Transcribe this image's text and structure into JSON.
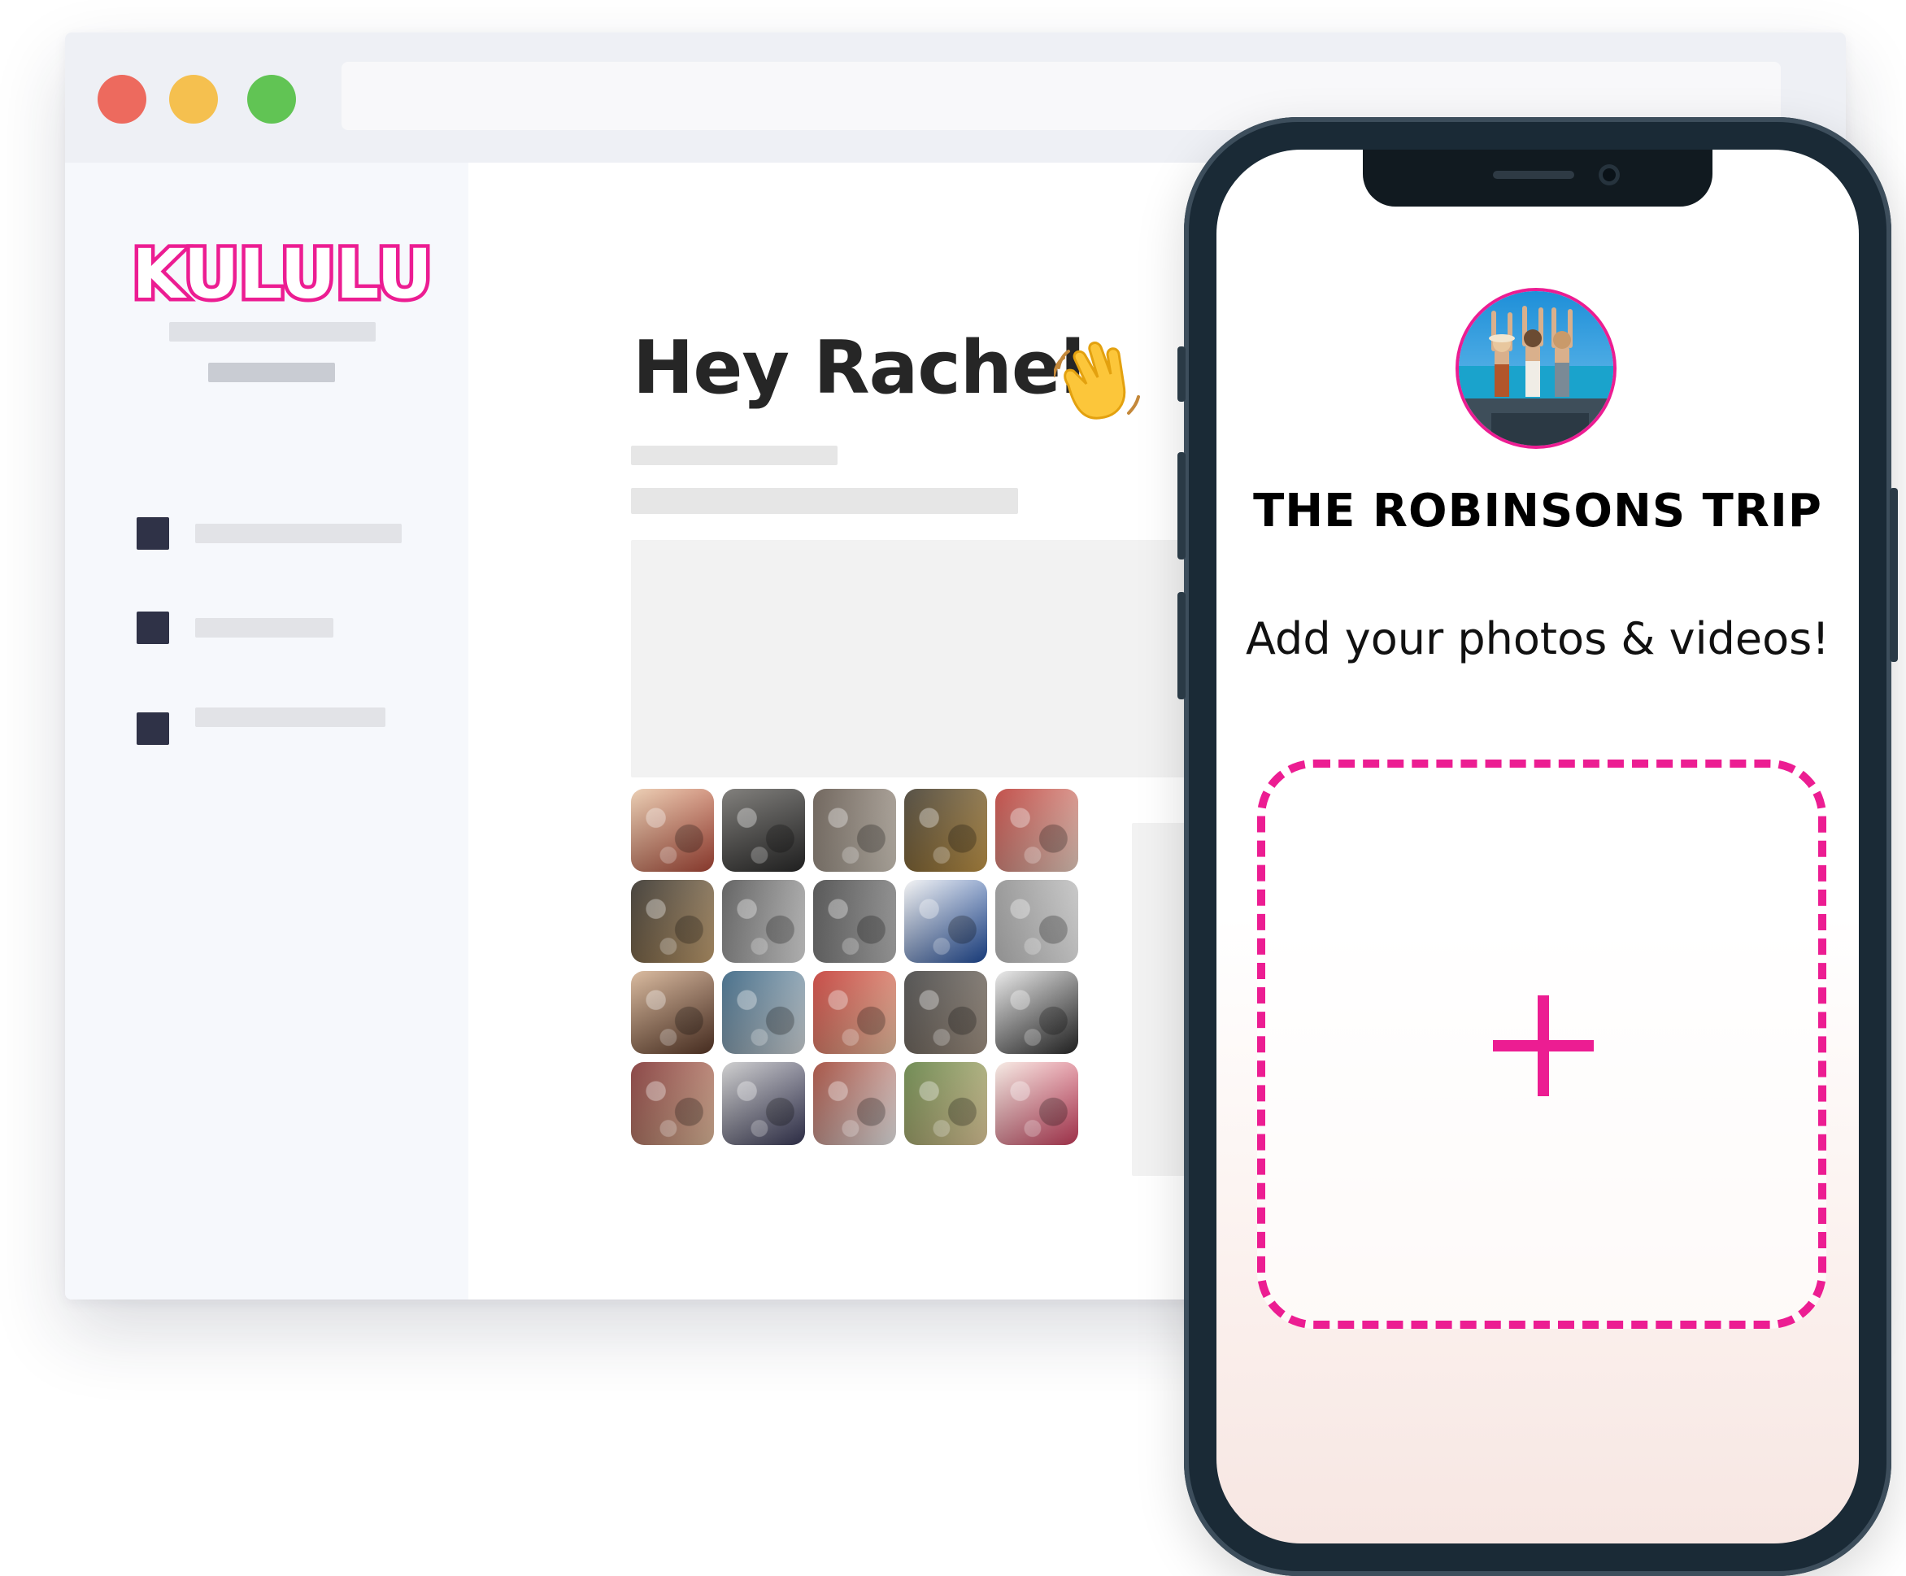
{
  "browser": {
    "window_controls": [
      "close",
      "minimize",
      "maximize"
    ],
    "address_bar": ""
  },
  "sidebar": {
    "logo_text": "KULULU",
    "nav_items": [
      "square-icon",
      "square-icon",
      "square-icon"
    ]
  },
  "main": {
    "greeting": "Hey Rachel",
    "greeting_emoji": "waving-hand-icon",
    "gallery_count": 20
  },
  "phone": {
    "trip_title": "THE ROBINSONS TRIP",
    "subtitle": "Add your photos & videos!",
    "upload_icon": "plus-icon"
  },
  "colors": {
    "brand_pink": "#ec1d92",
    "window_red": "#ed6a5e",
    "window_yellow": "#f5c04f",
    "window_green": "#61c454",
    "nav_square": "#2f3247"
  }
}
